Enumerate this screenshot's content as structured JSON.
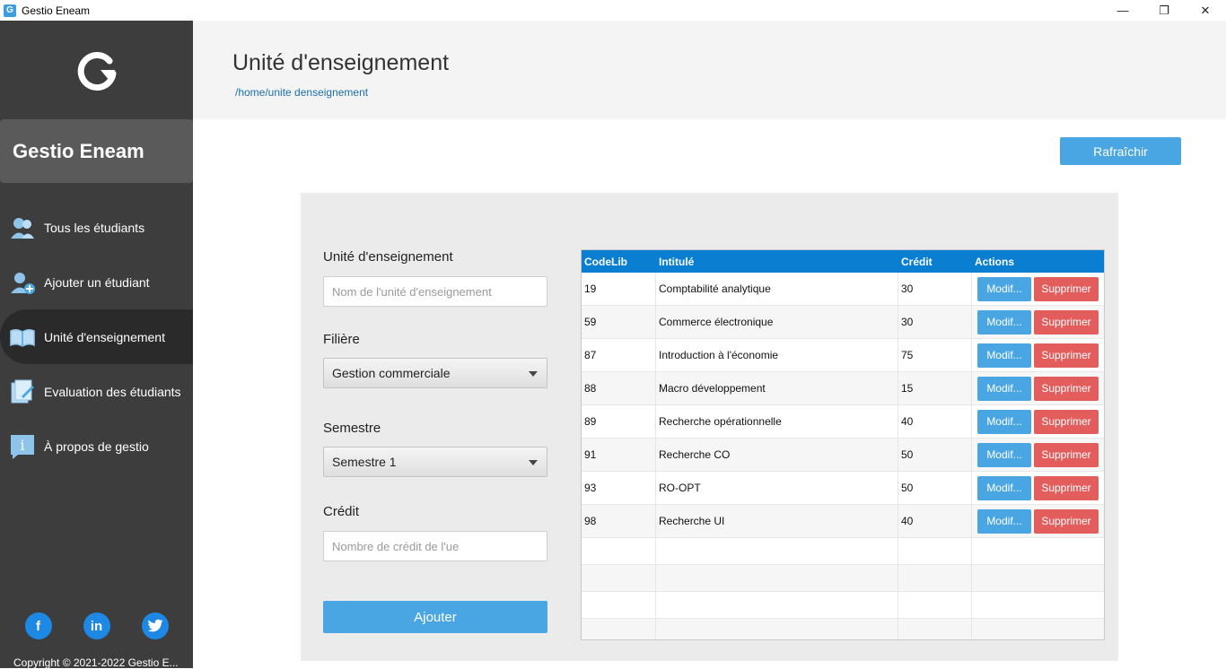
{
  "window": {
    "title": "Gestio Eneam",
    "app_icon_letter": "G",
    "controls": {
      "minimize": "—",
      "restore": "❐",
      "close": "✕"
    }
  },
  "sidebar": {
    "brand": "Gestio Eneam",
    "items": [
      {
        "label": "Tous les étudiants",
        "icon": "students-icon"
      },
      {
        "label": "Ajouter un étudiant",
        "icon": "add-student-icon"
      },
      {
        "label": "Unité d'enseignement",
        "icon": "book-icon",
        "active": true
      },
      {
        "label": "Evaluation des étudiants",
        "icon": "evaluation-icon"
      },
      {
        "label": "À propos de gestio",
        "icon": "info-icon"
      }
    ],
    "social": {
      "facebook": "f",
      "linkedin": "in",
      "twitter": "t"
    },
    "copyright": "Copyright © 2021-2022 Gestio E..."
  },
  "header": {
    "title": "Unité d'enseignement",
    "breadcrumb": "/home/unite denseignement"
  },
  "toolbar": {
    "refresh_label": "Rafraîchir"
  },
  "form": {
    "ue_label": "Unité d'enseignement",
    "ue_placeholder": "Nom de l'unité d'enseignement",
    "filiere_label": "Filière",
    "filiere_value": "Gestion commerciale",
    "semestre_label": "Semestre",
    "semestre_value": "Semestre 1",
    "credit_label": "Crédit",
    "credit_placeholder": "Nombre de crédit de l'ue",
    "add_label": "Ajouter"
  },
  "table": {
    "headers": [
      "CodeLib",
      "Intitulé",
      "Crédit",
      "Actions"
    ],
    "edit_label": "Modif...",
    "delete_label": "Supprimer",
    "rows": [
      {
        "code": "19",
        "intitule": "Comptabilité analytique",
        "credit": "30"
      },
      {
        "code": "59",
        "intitule": "Commerce électronique",
        "credit": "30"
      },
      {
        "code": "87",
        "intitule": "Introduction à l'économie",
        "credit": "75"
      },
      {
        "code": "88",
        "intitule": "Macro développement",
        "credit": "15"
      },
      {
        "code": "89",
        "intitule": "Recherche opérationnelle",
        "credit": "40"
      },
      {
        "code": "91",
        "intitule": "Recherche CO",
        "credit": "50"
      },
      {
        "code": "93",
        "intitule": "RO-OPT",
        "credit": "50"
      },
      {
        "code": "98",
        "intitule": "Recherche UI",
        "credit": "40"
      }
    ]
  }
}
